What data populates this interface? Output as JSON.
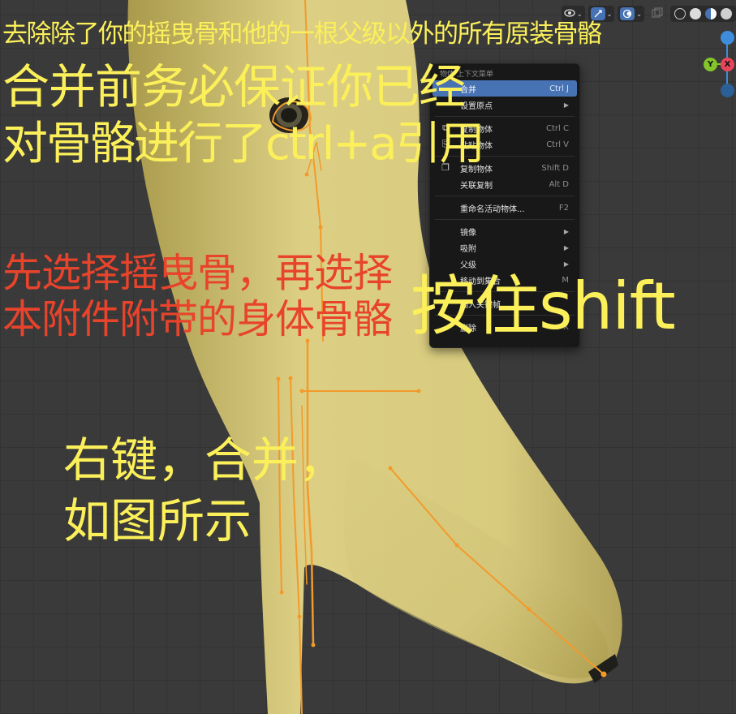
{
  "colors": {
    "annotation_yellow": "#fbf05a",
    "annotation_red": "#e8432b",
    "menu_highlight": "#4772b3",
    "bone_orange": "#f39a2a",
    "mesh_yellow": "#d9cc7f",
    "axis_x": "#e8455c",
    "axis_y": "#84c52b",
    "axis_z": "#3d8ddc"
  },
  "header": {
    "icons": [
      "eye-icon",
      "chevron-down-icon",
      "gizmo-icon",
      "chevron-down-icon",
      "overlay-icon",
      "chevron-down-icon",
      "xray-icon",
      "wireframe-icon",
      "solid-icon",
      "material-icon",
      "rendered-icon"
    ]
  },
  "gizmo": {
    "x_label": "X",
    "y_label": "Y"
  },
  "annotations": {
    "line1": "去除除了你的摇曳骨和他的一根父级以外的所有原装骨骼",
    "line2": "合并前务必保证你已经",
    "line3": "对骨骼进行了ctrl+a引用",
    "line4": "先选择摇曳骨，再选择",
    "line5": "本附件附带的身体骨骼",
    "line6": "按住shift",
    "line7": "右键，合并，",
    "line8": "如图所示"
  },
  "context_menu": {
    "title": "物体 上下文菜单",
    "items": [
      {
        "label": "合并",
        "shortcut": "Ctrl J",
        "icon": "",
        "submenu": false,
        "highlight": true
      },
      {
        "label": "设置原点",
        "shortcut": "",
        "icon": "",
        "submenu": true,
        "highlight": false
      },
      {
        "label": "复制物体",
        "shortcut": "Ctrl C",
        "icon": "copy-icon",
        "submenu": false,
        "highlight": false
      },
      {
        "label": "粘贴物体",
        "shortcut": "Ctrl V",
        "icon": "paste-icon",
        "submenu": false,
        "highlight": false
      },
      {
        "label": "复制物体",
        "shortcut": "Shift D",
        "icon": "duplicate-icon",
        "submenu": false,
        "highlight": false
      },
      {
        "label": "关联复制",
        "shortcut": "Alt D",
        "icon": "",
        "submenu": false,
        "highlight": false
      },
      {
        "label": "重命名活动物体...",
        "shortcut": "F2",
        "icon": "",
        "submenu": false,
        "highlight": false
      },
      {
        "label": "镜像",
        "shortcut": "",
        "icon": "",
        "submenu": true,
        "highlight": false
      },
      {
        "label": "吸附",
        "shortcut": "",
        "icon": "",
        "submenu": true,
        "highlight": false
      },
      {
        "label": "父级",
        "shortcut": "",
        "icon": "",
        "submenu": true,
        "highlight": false
      },
      {
        "label": "移动到集合",
        "shortcut": "M",
        "icon": "",
        "submenu": false,
        "highlight": false
      },
      {
        "label": "插入关键帧...",
        "shortcut": "",
        "icon": "",
        "submenu": false,
        "highlight": false
      },
      {
        "label": "删除",
        "shortcut": "X",
        "icon": "",
        "submenu": false,
        "highlight": false
      }
    ]
  }
}
